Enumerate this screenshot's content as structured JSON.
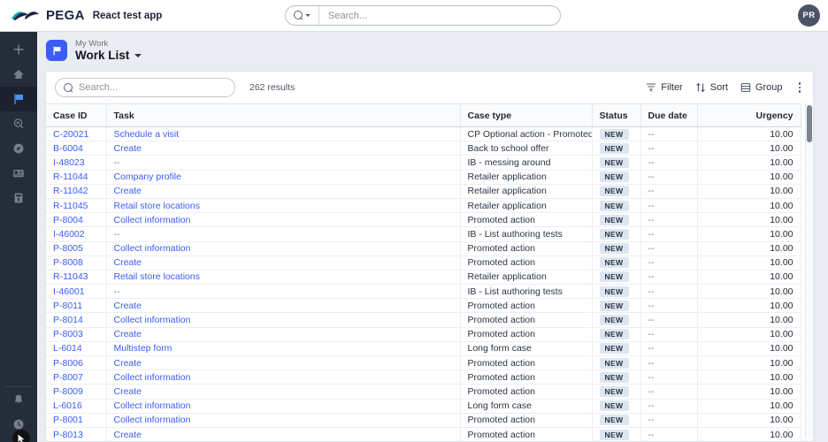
{
  "topbar": {
    "brand": "PEGA",
    "app_name": "React test app",
    "logo_colors": {
      "dark": "#1d2340",
      "teal": "#0fa8a8"
    },
    "search": {
      "placeholder": "Search...",
      "icon": "search-icon",
      "dropdown_icon": "caret-down-icon"
    },
    "avatar_initials": "PR"
  },
  "leftnav": {
    "items": [
      {
        "name": "create-new",
        "icon": "plus-icon",
        "active": false
      },
      {
        "name": "home",
        "icon": "home-icon",
        "active": false
      },
      {
        "name": "my-work",
        "icon": "flag-icon",
        "active": true
      },
      {
        "name": "case-search",
        "icon": "case-search-icon",
        "active": false
      },
      {
        "name": "dashboard",
        "icon": "compass-icon",
        "active": false
      },
      {
        "name": "explore-data",
        "icon": "id-card-icon",
        "active": false
      },
      {
        "name": "reports",
        "icon": "archive-icon",
        "active": false
      }
    ],
    "bottom_items": [
      {
        "name": "notifications",
        "icon": "bell-icon"
      },
      {
        "name": "recents",
        "icon": "clock-icon"
      }
    ]
  },
  "page_header": {
    "breadcrumb": "My Work",
    "title": "Work List",
    "icon": "flag-square-icon",
    "dropdown_icon": "caret-down-icon",
    "accent": "#3b5cf5"
  },
  "toolbar": {
    "search_placeholder": "Search...",
    "results_text": "262 results",
    "filter_label": "Filter",
    "sort_label": "Sort",
    "group_label": "Group",
    "more_label": "More actions"
  },
  "table": {
    "columns": [
      "Case ID",
      "Task",
      "Case type",
      "Status",
      "Due date",
      "Urgency"
    ],
    "rows": [
      {
        "case_id": "C-20021",
        "task": "Schedule a visit",
        "case_type": "CP Optional action - Promoted",
        "status": "NEW",
        "due_date": "--",
        "urgency": "10.00"
      },
      {
        "case_id": "B-6004",
        "task": "Create",
        "case_type": "Back to school offer",
        "status": "NEW",
        "due_date": "--",
        "urgency": "10.00"
      },
      {
        "case_id": "I-48023",
        "task": "--",
        "case_type": "IB - messing around",
        "status": "NEW",
        "due_date": "--",
        "urgency": "10.00"
      },
      {
        "case_id": "R-11044",
        "task": "Company profile",
        "case_type": "Retailer application",
        "status": "NEW",
        "due_date": "--",
        "urgency": "10.00"
      },
      {
        "case_id": "R-11042",
        "task": "Create",
        "case_type": "Retailer application",
        "status": "NEW",
        "due_date": "--",
        "urgency": "10.00"
      },
      {
        "case_id": "R-11045",
        "task": "Retail store locations",
        "case_type": "Retailer application",
        "status": "NEW",
        "due_date": "--",
        "urgency": "10.00"
      },
      {
        "case_id": "P-8004",
        "task": "Collect information",
        "case_type": "Promoted action",
        "status": "NEW",
        "due_date": "--",
        "urgency": "10.00"
      },
      {
        "case_id": "I-46002",
        "task": "--",
        "case_type": "IB - List authoring tests",
        "status": "NEW",
        "due_date": "--",
        "urgency": "10.00"
      },
      {
        "case_id": "P-8005",
        "task": "Collect information",
        "case_type": "Promoted action",
        "status": "NEW",
        "due_date": "--",
        "urgency": "10.00"
      },
      {
        "case_id": "P-8008",
        "task": "Create",
        "case_type": "Promoted action",
        "status": "NEW",
        "due_date": "--",
        "urgency": "10.00"
      },
      {
        "case_id": "R-11043",
        "task": "Retail store locations",
        "case_type": "Retailer application",
        "status": "NEW",
        "due_date": "--",
        "urgency": "10.00"
      },
      {
        "case_id": "I-46001",
        "task": "--",
        "case_type": "IB - List authoring tests",
        "status": "NEW",
        "due_date": "--",
        "urgency": "10.00"
      },
      {
        "case_id": "P-8011",
        "task": "Create",
        "case_type": "Promoted action",
        "status": "NEW",
        "due_date": "--",
        "urgency": "10.00"
      },
      {
        "case_id": "P-8014",
        "task": "Collect information",
        "case_type": "Promoted action",
        "status": "NEW",
        "due_date": "--",
        "urgency": "10.00"
      },
      {
        "case_id": "P-8003",
        "task": "Create",
        "case_type": "Promoted action",
        "status": "NEW",
        "due_date": "--",
        "urgency": "10.00"
      },
      {
        "case_id": "L-6014",
        "task": "Multistep form",
        "case_type": "Long form case",
        "status": "NEW",
        "due_date": "--",
        "urgency": "10.00"
      },
      {
        "case_id": "P-8006",
        "task": "Create",
        "case_type": "Promoted action",
        "status": "NEW",
        "due_date": "--",
        "urgency": "10.00"
      },
      {
        "case_id": "P-8007",
        "task": "Collect information",
        "case_type": "Promoted action",
        "status": "NEW",
        "due_date": "--",
        "urgency": "10.00"
      },
      {
        "case_id": "P-8009",
        "task": "Create",
        "case_type": "Promoted action",
        "status": "NEW",
        "due_date": "--",
        "urgency": "10.00"
      },
      {
        "case_id": "L-6016",
        "task": "Collect information",
        "case_type": "Long form case",
        "status": "NEW",
        "due_date": "--",
        "urgency": "10.00"
      },
      {
        "case_id": "P-8001",
        "task": "Collect information",
        "case_type": "Promoted action",
        "status": "NEW",
        "due_date": "--",
        "urgency": "10.00"
      },
      {
        "case_id": "P-8013",
        "task": "Create",
        "case_type": "Promoted action",
        "status": "NEW",
        "due_date": "--",
        "urgency": "10.00"
      }
    ]
  }
}
